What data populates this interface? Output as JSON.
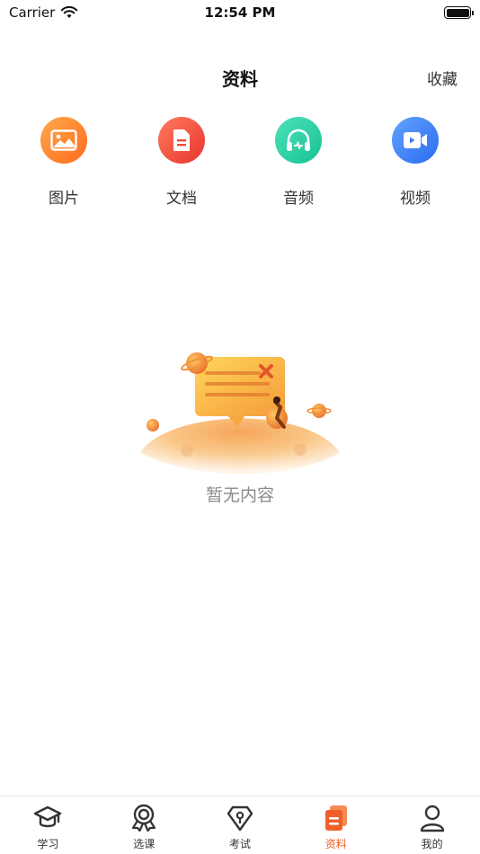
{
  "status_bar": {
    "carrier": "Carrier",
    "time": "12:54 PM",
    "battery_level": 1.0
  },
  "nav": {
    "title": "资料",
    "right_action": "收藏"
  },
  "categories": [
    {
      "label": "图片",
      "icon": "image-icon",
      "color_from": "#ff9a3c",
      "color_to": "#ff6a1f"
    },
    {
      "label": "文档",
      "icon": "document-icon",
      "color_from": "#ff6a5a",
      "color_to": "#e83a32"
    },
    {
      "label": "音频",
      "icon": "headphones-icon",
      "color_from": "#45dfb4",
      "color_to": "#18c495"
    },
    {
      "label": "视频",
      "icon": "video-icon",
      "color_from": "#5c9bff",
      "color_to": "#2f6ff0"
    }
  ],
  "empty_state": {
    "text": "暂无内容"
  },
  "tab_bar": {
    "active_color": "#f0602b",
    "items": [
      {
        "label": "学习",
        "icon": "graduation-cap-icon",
        "active": false
      },
      {
        "label": "选课",
        "icon": "award-ribbon-icon",
        "active": false
      },
      {
        "label": "考试",
        "icon": "pen-nib-icon",
        "active": false
      },
      {
        "label": "资料",
        "icon": "files-icon",
        "active": true
      },
      {
        "label": "我的",
        "icon": "person-icon",
        "active": false
      }
    ]
  }
}
